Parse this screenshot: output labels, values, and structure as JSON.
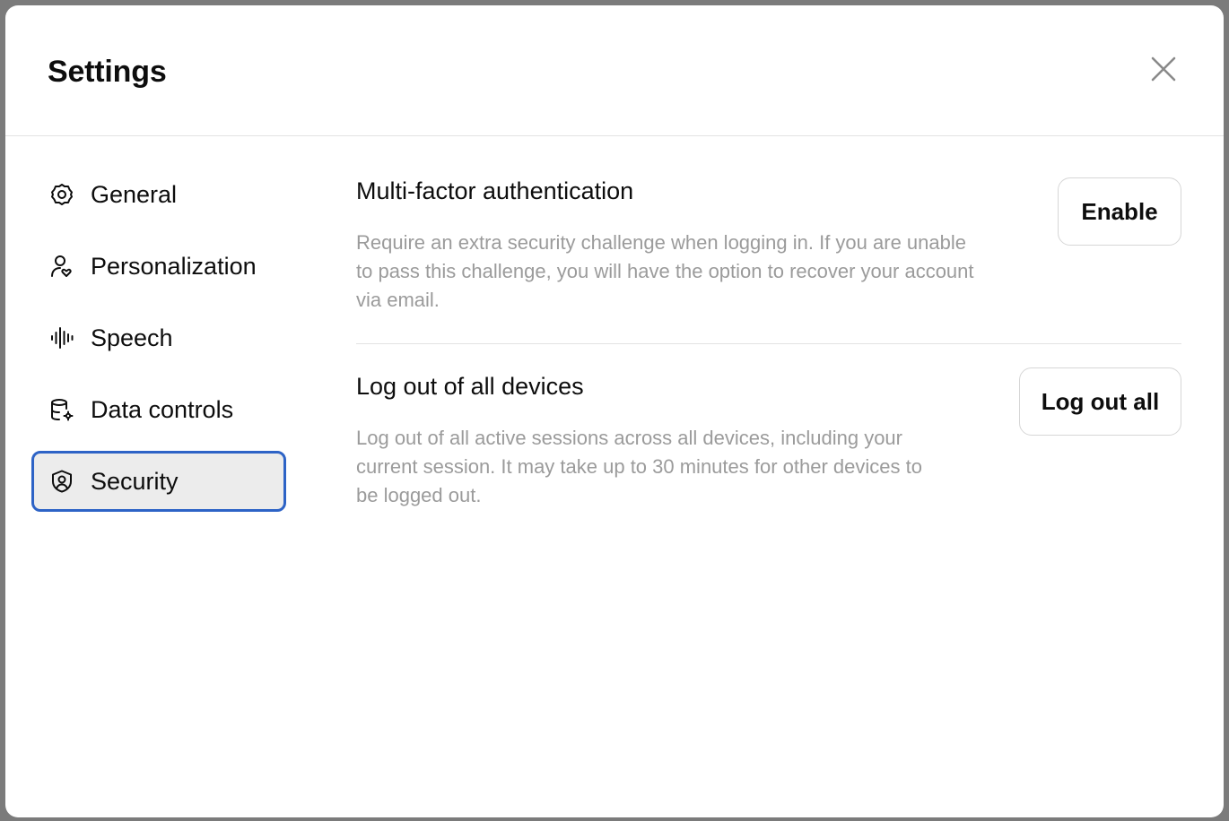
{
  "modal": {
    "title": "Settings"
  },
  "sidebar": {
    "items": [
      {
        "label": "General",
        "icon": "gear-icon",
        "active": false
      },
      {
        "label": "Personalization",
        "icon": "person-heart-icon",
        "active": false
      },
      {
        "label": "Speech",
        "icon": "audio-waveform-icon",
        "active": false
      },
      {
        "label": "Data controls",
        "icon": "database-gear-icon",
        "active": false
      },
      {
        "label": "Security",
        "icon": "shield-user-icon",
        "active": true
      }
    ]
  },
  "security": {
    "mfa": {
      "title": "Multi-factor authentication",
      "description": "Require an extra security challenge when logging in. If you are unable to pass this challenge, you will have the option to recover your account via email.",
      "button_label": "Enable"
    },
    "logout": {
      "title": "Log out of all devices",
      "description": "Log out of all active sessions across all devices, including your current session. It may take up to 30 minutes for other devices to be logged out.",
      "button_label": "Log out all"
    }
  },
  "colors": {
    "focus_ring": "#2d63c6",
    "active_bg": "#ececec",
    "muted_text": "#9b9b9b"
  }
}
